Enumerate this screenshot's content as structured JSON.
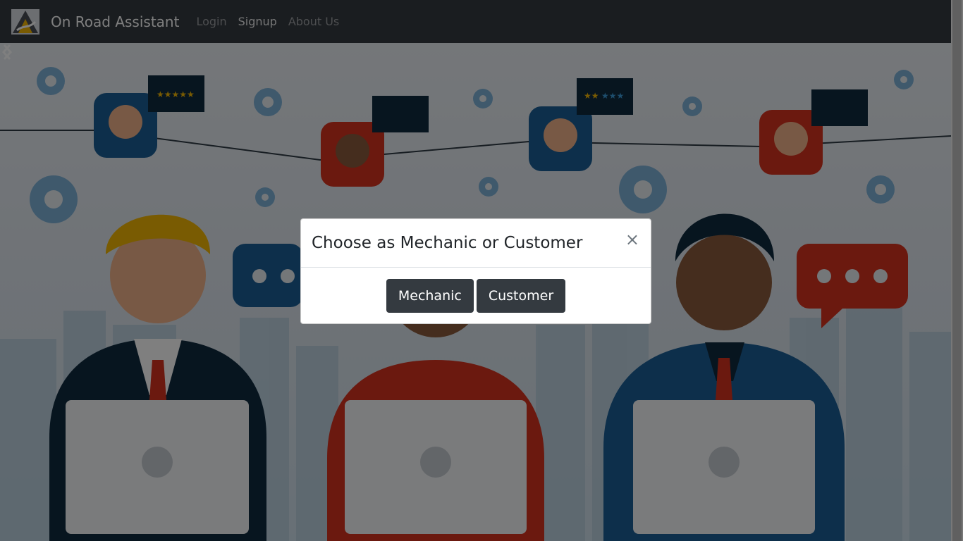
{
  "navbar": {
    "brand": "On Road Assistant",
    "logo_icon": "road-logo-icon",
    "links": [
      {
        "label": "Login",
        "active": false
      },
      {
        "label": "Signup",
        "active": true
      },
      {
        "label": "About Us",
        "active": false
      }
    ]
  },
  "hero": {
    "illustration": "customer-support-agents-illustration",
    "controls": [
      "carousel-prev-icon",
      "carousel-next-icon"
    ]
  },
  "modal": {
    "title": "Choose as Mechanic or Customer",
    "close_symbol": "×",
    "buttons": {
      "mechanic": "Mechanic",
      "customer": "Customer"
    }
  },
  "colors": {
    "navbar": "#343a40",
    "button": "#343a40",
    "accent_red": "#d6321e",
    "accent_blue": "#1b5f97"
  }
}
